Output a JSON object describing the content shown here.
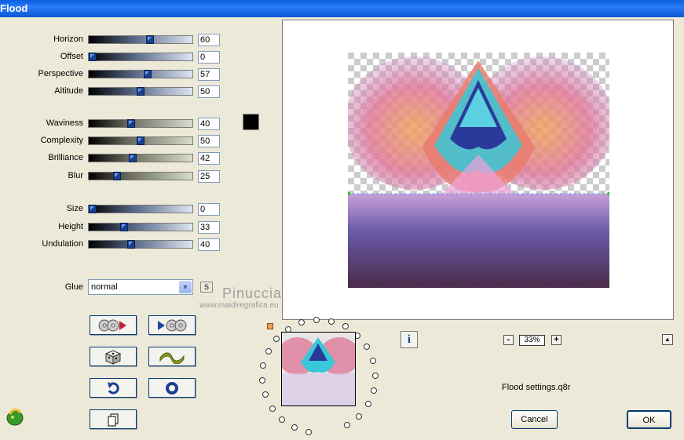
{
  "window": {
    "title": "Flood"
  },
  "sliders": [
    {
      "label": "Horizon",
      "value": "60",
      "style": "blue",
      "level": 0.6
    },
    {
      "label": "Offset",
      "value": "0",
      "style": "blue",
      "level": 0.0
    },
    {
      "label": "Perspective",
      "value": "57",
      "style": "blue",
      "level": 0.57
    },
    {
      "label": "Altitude",
      "value": "50",
      "style": "blue",
      "level": 0.5
    },
    {
      "label": "Waviness",
      "value": "40",
      "style": "grey",
      "level": 0.4
    },
    {
      "label": "Complexity",
      "value": "50",
      "style": "grey",
      "level": 0.5
    },
    {
      "label": "Brilliance",
      "value": "42",
      "style": "grey",
      "level": 0.42
    },
    {
      "label": "Blur",
      "value": "25",
      "style": "grey",
      "level": 0.25
    },
    {
      "label": "Size",
      "value": "0",
      "style": "blue",
      "level": 0.0
    },
    {
      "label": "Height",
      "value": "33",
      "style": "blue",
      "level": 0.33
    },
    {
      "label": "Undulation",
      "value": "40",
      "style": "blue",
      "level": 0.4
    }
  ],
  "color_swatch": "#000000",
  "glue": {
    "label": "Glue",
    "value": "normal",
    "s_button": "S"
  },
  "watermark": {
    "name": "Pinuccia",
    "site": "www.maidiregrafica.eu"
  },
  "tool_buttons": [
    {
      "icon": "load-preset-icon"
    },
    {
      "icon": "save-preset-icon"
    },
    {
      "icon": "randomize-dice-icon"
    },
    {
      "icon": "wave-icon"
    },
    {
      "icon": "undo-icon"
    },
    {
      "icon": "reset-icon"
    },
    {
      "icon": "copy-icon"
    }
  ],
  "zoom": {
    "minus": "-",
    "value": "33%",
    "plus": "+"
  },
  "settings_file": "Flood settings.q8r",
  "buttons": {
    "cancel": "Cancel",
    "ok": "OK"
  },
  "info_button": "i"
}
